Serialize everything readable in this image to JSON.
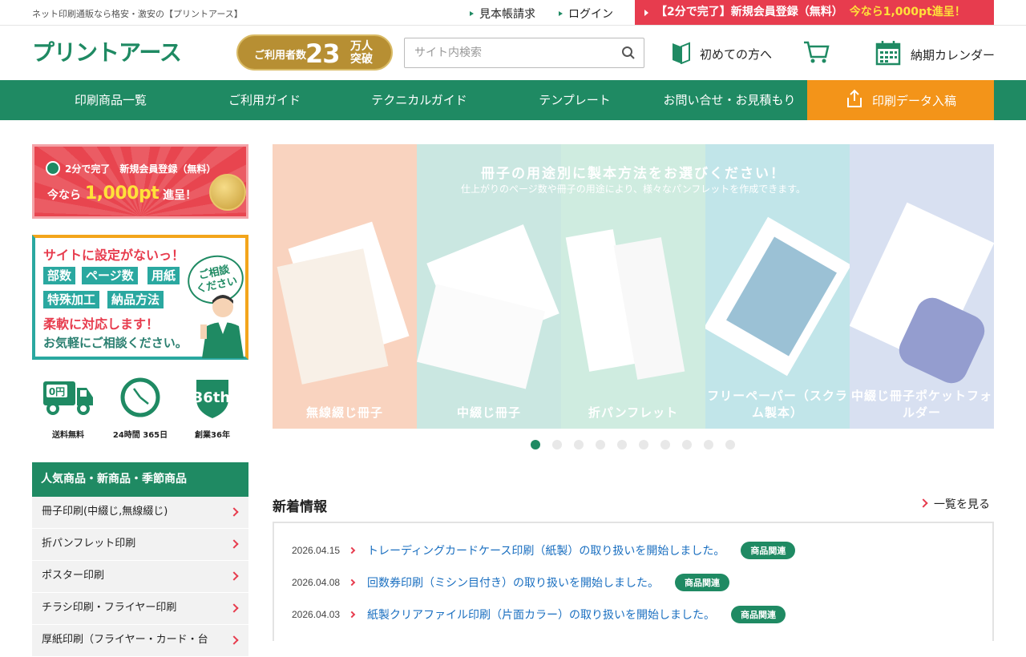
{
  "topbar": {
    "tagline": "ネット印刷通販なら格安・激安の【プリントアース】",
    "sample_link": "見本帳請求",
    "login_link": "ログイン",
    "cta_main": "【2分で完了】新規会員登録（無料）",
    "cta_highlight": "今なら1,000pt進呈！"
  },
  "header": {
    "logo": "プリントアース",
    "badge_small": "ご利用者数",
    "badge_big": "23",
    "badge_unit_1": "万人",
    "badge_unit_2": "突破",
    "search_placeholder": "サイト内検索",
    "beginner_link": "初めての方へ",
    "calendar_link": "納期カレンダー"
  },
  "nav": {
    "items": [
      "印刷商品一覧",
      "ご利用ガイド",
      "テクニカルガイド",
      "テンプレート",
      "お問い合せ・お見積もり"
    ],
    "upload": "印刷データ入稿"
  },
  "sidebar": {
    "promo1_line1": "2分で完了　新規会員登録（無料）",
    "promo1_now": "今なら",
    "promo1_points": "1,000pt",
    "promo1_suffix": "進呈！",
    "promo2_head": "サイトに設定がないっ！",
    "promo2_tags": [
      "部数",
      "ページ数",
      "用紙",
      "特殊加工",
      "納品方法"
    ],
    "promo2_line1": "柔軟に対応します！",
    "promo2_line2": "お気軽にご相談ください。",
    "promo2_bubble_1": "ご相談",
    "promo2_bubble_2": "ください",
    "features": [
      {
        "label": "送料無料",
        "icon_text": "0円"
      },
      {
        "label": "24時間 365日",
        "icon_text": ""
      },
      {
        "label": "創業36年",
        "icon_text": "36th"
      }
    ],
    "category_title": "人気商品・新商品・季節商品",
    "categories": [
      "冊子印刷(中綴じ,無線綴じ)",
      "折パンフレット印刷",
      "ポスター印刷",
      "チラシ印刷・フライヤー印刷",
      "厚紙印刷（フライヤー・カード・台"
    ]
  },
  "hero": {
    "title": "冊子の用途別に製本方法をお選びください！",
    "subtitle": "仕上がりのページ数や冊子の用途により、様々なパンフレットを作成できます。",
    "panels": [
      "無線綴じ冊子",
      "中綴じ冊子",
      "折パンフレット",
      "フリーペーパー（スクラム製本）",
      "中綴じ冊子ポケットフォルダー"
    ],
    "panel_colors": [
      "#f4b08a",
      "#9fd3c9",
      "#a8ddc6",
      "#8fd0d8",
      "#b9c7e6"
    ],
    "slide_count": 10,
    "active_slide": 1
  },
  "news": {
    "title": "新着情報",
    "more": "一覧を見る",
    "items": [
      {
        "date": "2026.04.15",
        "text": "トレーディングカードケース印刷（紙製）の取り扱いを開始しました。",
        "tag": "商品関連"
      },
      {
        "date": "2026.04.08",
        "text": "回数券印刷（ミシン目付き）の取り扱いを開始しました。",
        "tag": "商品関連"
      },
      {
        "date": "2026.04.03",
        "text": "紙製クリアファイル印刷（片面カラー）の取り扱いを開始しました。",
        "tag": "商品関連"
      }
    ]
  },
  "colors": {
    "brand_green": "#1f8a63",
    "accent_red": "#e73c4e",
    "accent_orange": "#f39419",
    "link_blue": "#1a6fc0"
  }
}
